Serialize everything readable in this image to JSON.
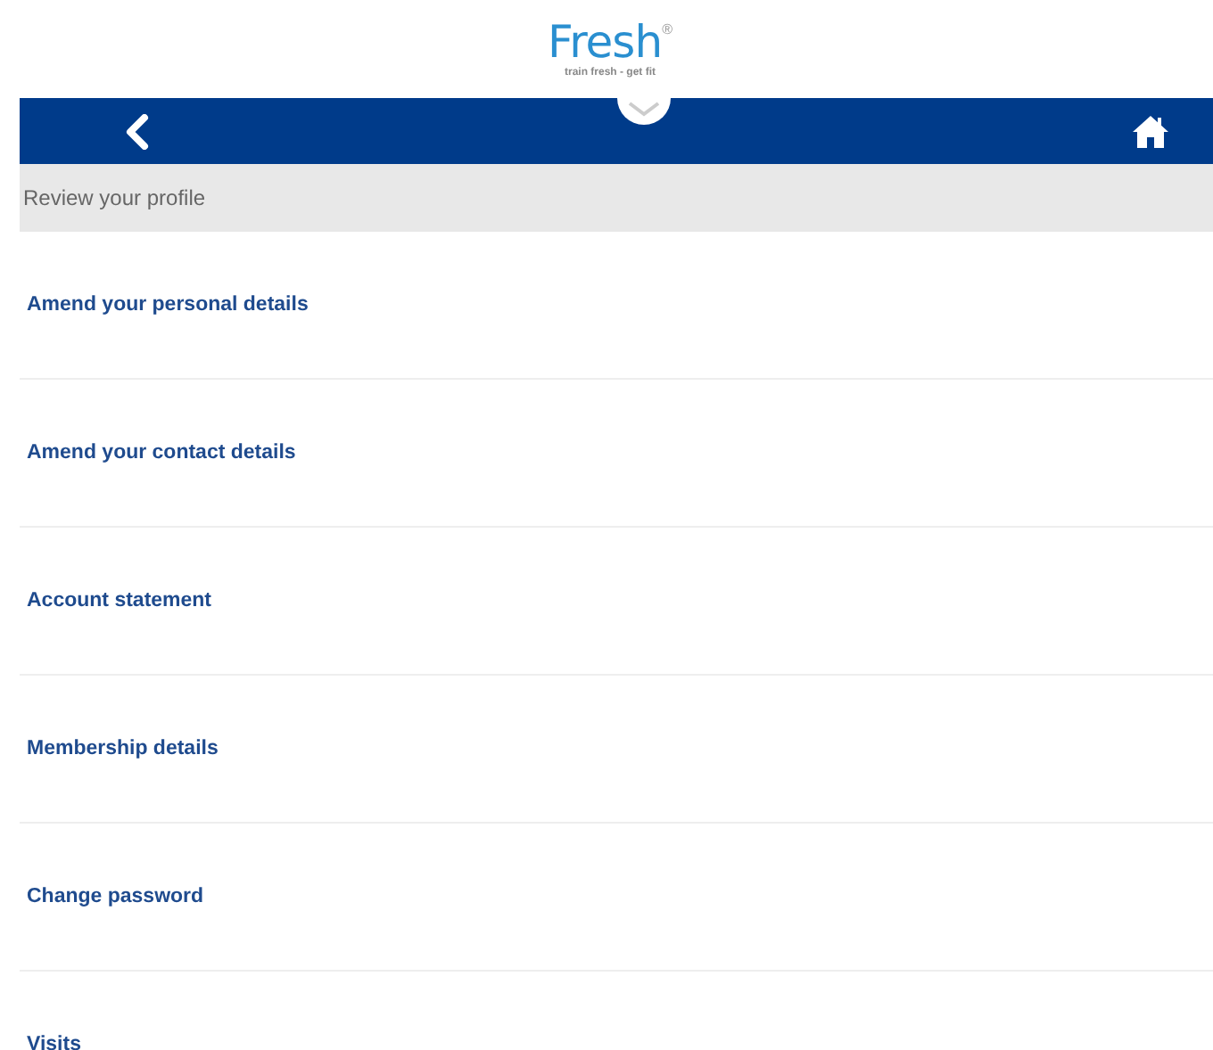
{
  "logo": {
    "name": "Fresh",
    "mark": "®",
    "tagline": "train fresh - get fit"
  },
  "section_header": "Review your profile",
  "menu_items": [
    {
      "label": "Amend your personal details"
    },
    {
      "label": "Amend your contact details"
    },
    {
      "label": "Account statement"
    },
    {
      "label": "Membership details"
    },
    {
      "label": "Change password"
    },
    {
      "label": "Visits"
    }
  ]
}
